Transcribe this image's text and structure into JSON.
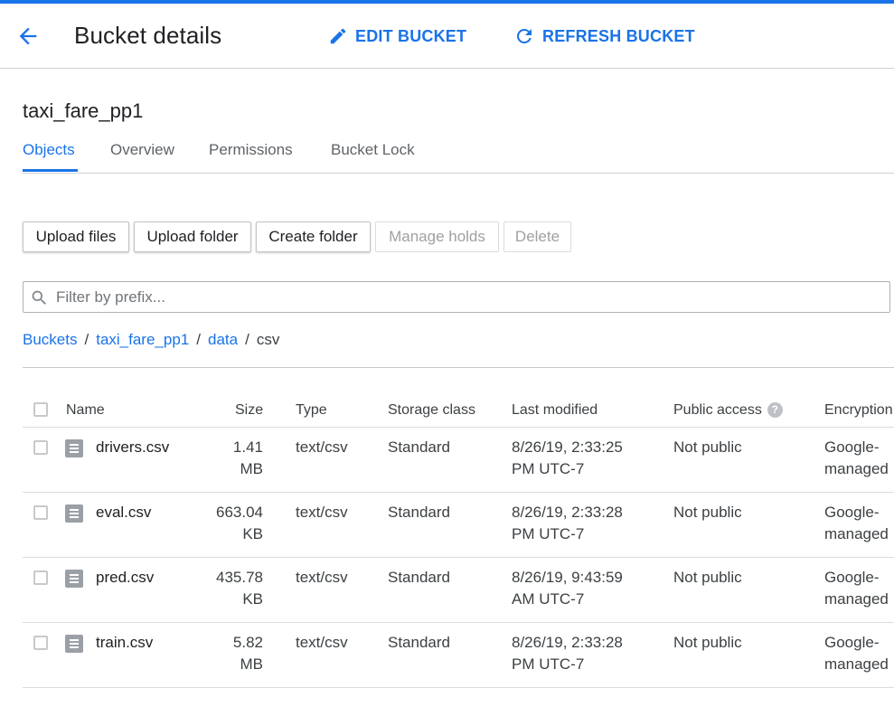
{
  "header": {
    "title": "Bucket details",
    "edit_label": "EDIT BUCKET",
    "refresh_label": "REFRESH BUCKET"
  },
  "bucket": {
    "name": "taxi_fare_pp1"
  },
  "tabs": [
    {
      "label": "Objects",
      "active": true
    },
    {
      "label": "Overview",
      "active": false
    },
    {
      "label": "Permissions",
      "active": false
    },
    {
      "label": "Bucket Lock",
      "active": false
    }
  ],
  "actions": {
    "upload_files": "Upload files",
    "upload_folder": "Upload folder",
    "create_folder": "Create folder",
    "manage_holds": "Manage holds",
    "delete": "Delete"
  },
  "filter": {
    "placeholder": "Filter by prefix..."
  },
  "breadcrumb": {
    "items": [
      "Buckets",
      "taxi_fare_pp1",
      "data"
    ],
    "current": "csv",
    "separator": "/"
  },
  "table": {
    "headers": {
      "name": "Name",
      "size": "Size",
      "type": "Type",
      "storage_class": "Storage class",
      "last_modified": "Last modified",
      "public_access": "Public access",
      "encryption": "Encryption"
    },
    "help_glyph": "?",
    "rows": [
      {
        "name": "drivers.csv",
        "size_1": "1.41",
        "size_2": "MB",
        "type": "text/csv",
        "storage_class": "Standard",
        "modified_1": "8/26/19, 2:33:25",
        "modified_2": "PM UTC-7",
        "public_access": "Not public",
        "enc_1": "Google-",
        "enc_2": "managed"
      },
      {
        "name": "eval.csv",
        "size_1": "663.04",
        "size_2": "KB",
        "type": "text/csv",
        "storage_class": "Standard",
        "modified_1": "8/26/19, 2:33:28",
        "modified_2": "PM UTC-7",
        "public_access": "Not public",
        "enc_1": "Google-",
        "enc_2": "managed"
      },
      {
        "name": "pred.csv",
        "size_1": "435.78",
        "size_2": "KB",
        "type": "text/csv",
        "storage_class": "Standard",
        "modified_1": "8/26/19, 9:43:59",
        "modified_2": "AM UTC-7",
        "public_access": "Not public",
        "enc_1": "Google-",
        "enc_2": "managed"
      },
      {
        "name": "train.csv",
        "size_1": "5.82",
        "size_2": "MB",
        "type": "text/csv",
        "storage_class": "Standard",
        "modified_1": "8/26/19, 2:33:28",
        "modified_2": "PM UTC-7",
        "public_access": "Not public",
        "enc_1": "Google-",
        "enc_2": "managed"
      }
    ]
  },
  "icons": {
    "back": "arrow-back-icon",
    "edit": "pencil-icon",
    "refresh": "refresh-icon",
    "search": "search-icon",
    "file": "file-icon",
    "help": "help-icon"
  },
  "colors": {
    "accent": "#1a73e8",
    "text": "#202124",
    "muted": "#5f6368",
    "disabled": "#a0a0a0"
  }
}
